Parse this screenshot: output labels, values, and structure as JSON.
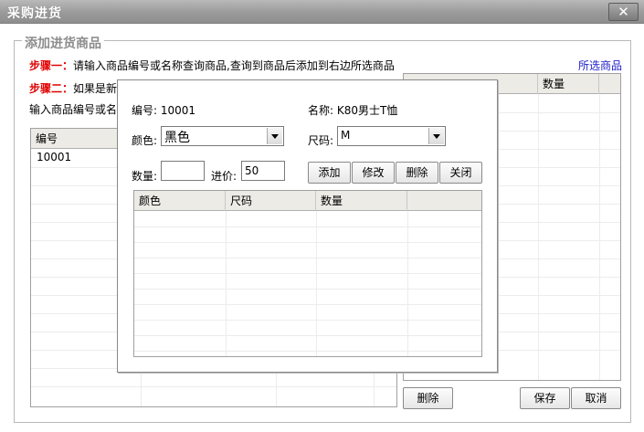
{
  "window": {
    "title": "采购进货",
    "close_glyph": "✕"
  },
  "group": {
    "legend": "添加进货商品"
  },
  "steps": {
    "step1_label": "步骤一：",
    "step1_text": "请输入商品编号或名称查询商品,查询到商品后添加到右边所选商品",
    "step2_label": "步骤二：",
    "step2_text": "如果是新",
    "search_prompt": "输入商品编号或名"
  },
  "selected_link": "所选商品",
  "left_table": {
    "headers": [
      "编号"
    ],
    "rows": [
      [
        "10001"
      ]
    ]
  },
  "right_table": {
    "headers": [
      "",
      "数量"
    ]
  },
  "bottom_buttons": {
    "delete": "删除",
    "save": "保存",
    "cancel": "取消"
  },
  "dialog": {
    "code_label": "编号:",
    "code_value": "10001",
    "name_label": "名称:",
    "name_value": "K80男士T恤",
    "color_label": "颜色:",
    "color_value": "黑色",
    "size_label": "尺码:",
    "size_value": "M",
    "qty_label": "数量:",
    "qty_value": "",
    "price_label": "进价:",
    "price_value": "50",
    "buttons": {
      "add": "添加",
      "modify": "修改",
      "delete": "删除",
      "close": "关闭"
    },
    "table_headers": [
      "颜色",
      "尺码",
      "数量",
      ""
    ]
  },
  "colors": {
    "step_label": "#e00000",
    "link": "#1c1cc8",
    "titlebar": "#9a9a9a"
  }
}
